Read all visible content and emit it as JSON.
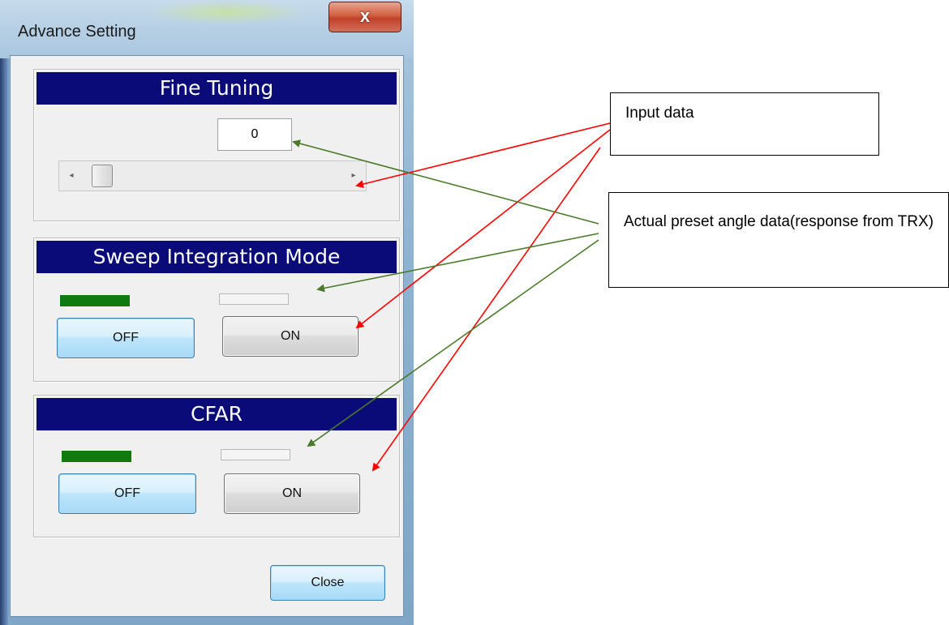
{
  "window": {
    "title": "Advance Setting",
    "close_glyph": "x"
  },
  "fine_tuning": {
    "header": "Fine Tuning",
    "value": "0",
    "scroll_left_glyph": "◂",
    "scroll_right_glyph": "▸"
  },
  "sweep_integration": {
    "header": "Sweep Integration Mode",
    "off_label": "OFF",
    "on_label": "ON",
    "state": "OFF"
  },
  "cfar": {
    "header": "CFAR",
    "off_label": "OFF",
    "on_label": "ON",
    "state": "OFF"
  },
  "footer": {
    "close_label": "Close"
  },
  "annotations": {
    "input_data": "Input data",
    "actual_data": "Actual preset angle data(response from TRX)"
  },
  "colors": {
    "header_bg": "#0a0a78",
    "indicator_on": "#107a10",
    "arrow_input": "#ff0000",
    "arrow_actual": "#4a7a2a"
  }
}
